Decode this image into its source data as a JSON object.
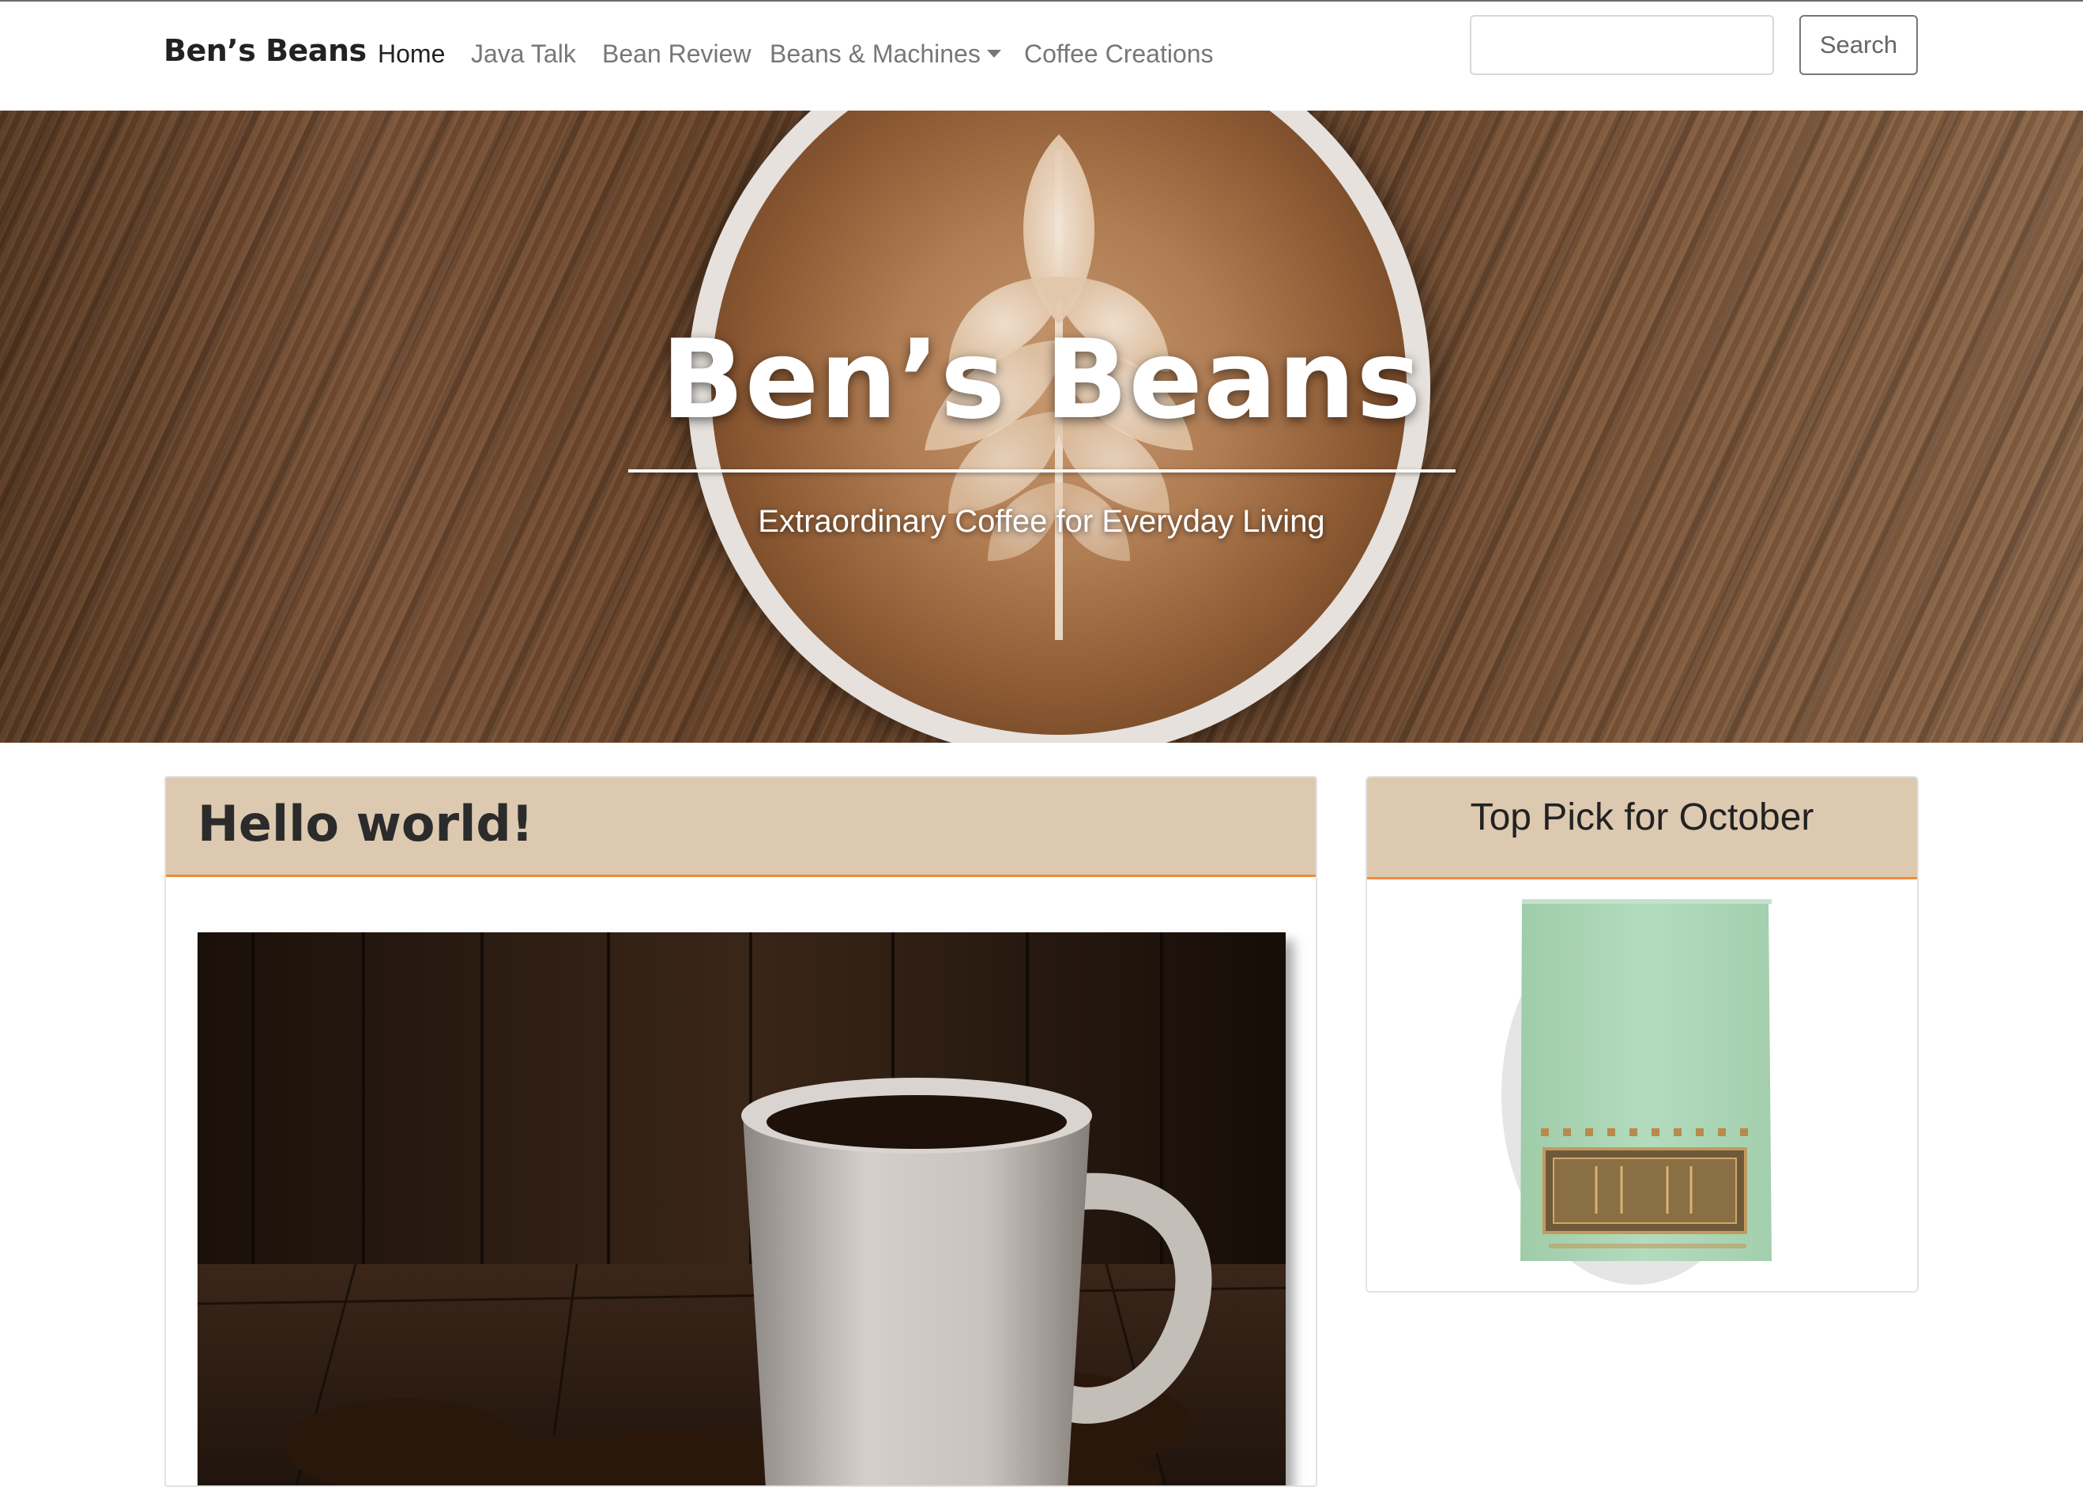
{
  "nav": {
    "brand": "Ben’s Beans",
    "items": [
      {
        "label": "Home",
        "active": true
      },
      {
        "label": "Java Talk",
        "active": false
      },
      {
        "label": "Bean Review",
        "active": false
      },
      {
        "label": "Beans & Machines",
        "active": false,
        "dropdown": true
      },
      {
        "label": "Coffee Creations",
        "active": false
      }
    ],
    "search": {
      "placeholder": "",
      "value": "",
      "button_label": "Search"
    }
  },
  "hero": {
    "title": "Ben’s Beans",
    "subtitle": "Extraordinary Coffee for Everyday Living"
  },
  "post": {
    "title": "Hello world!"
  },
  "sidebar": {
    "title": "Top Pick for October"
  },
  "colors": {
    "card_header_bg": "#dcc9b0",
    "card_header_border": "#f08a3a",
    "nav_text": "#777777",
    "nav_active": "#222222",
    "bag_green": "#a9d5b6"
  }
}
